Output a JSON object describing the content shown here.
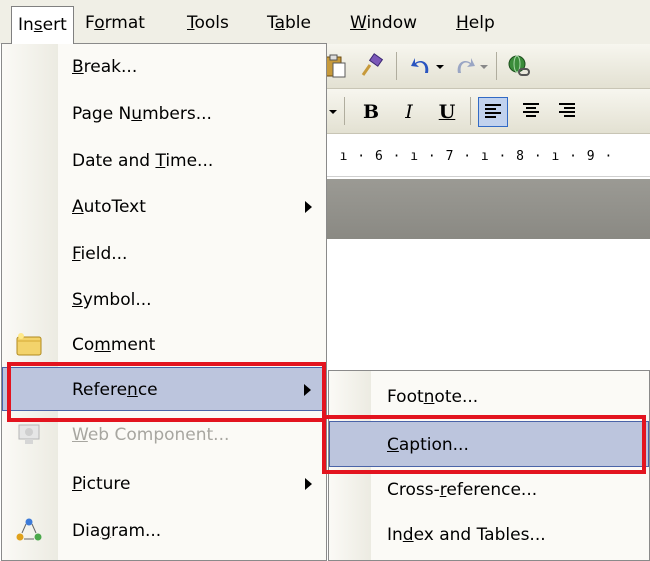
{
  "menubar": {
    "items": [
      {
        "label": "Insert",
        "mnemonic_index": 2
      },
      {
        "label": "Format",
        "mnemonic_index": 1
      },
      {
        "label": "Tools",
        "mnemonic_index": 0
      },
      {
        "label": "Table",
        "mnemonic_index": 1
      },
      {
        "label": "Window",
        "mnemonic_index": 0
      },
      {
        "label": "Help",
        "mnemonic_index": 0
      }
    ]
  },
  "insert_menu": {
    "items": [
      {
        "label": "Break...",
        "mnemonic_index": 0
      },
      {
        "label": "Page Numbers...",
        "mnemonic_index": 6
      },
      {
        "label": "Date and Time...",
        "mnemonic_index": 9
      },
      {
        "label": "AutoText",
        "mnemonic_index": 0,
        "has_submenu": true
      },
      {
        "label": "Field...",
        "mnemonic_index": 0
      },
      {
        "label": "Symbol...",
        "mnemonic_index": 0
      },
      {
        "label": "Comment",
        "mnemonic_index": 2,
        "icon": "comment-icon"
      },
      {
        "label": "Reference",
        "mnemonic_index": 6,
        "has_submenu": true,
        "highlighted": true
      },
      {
        "label": "Web Component...",
        "mnemonic_index": 0,
        "disabled": true,
        "icon": "web-component-icon"
      },
      {
        "label": "Picture",
        "mnemonic_index": 0,
        "has_submenu": true
      },
      {
        "label": "Diagram...",
        "mnemonic_index": 3,
        "icon": "diagram-icon"
      }
    ]
  },
  "reference_submenu": {
    "items": [
      {
        "label": "Footnote...",
        "mnemonic_index": 4
      },
      {
        "label": "Caption...",
        "mnemonic_index": 0,
        "highlighted": true
      },
      {
        "label": "Cross-reference...",
        "mnemonic_index": 6
      },
      {
        "label": "Index and Tables...",
        "mnemonic_index": 2
      }
    ]
  },
  "toolbar": {
    "format_buttons": [
      {
        "label": "B",
        "name": "bold-button"
      },
      {
        "label": "I",
        "name": "italic-button"
      },
      {
        "label": "U",
        "name": "underline-button"
      }
    ]
  },
  "ruler": {
    "text": "· ı · 6 · ı · 7 · ı · 8 · ı · 9 ·"
  },
  "colors": {
    "highlight": "#bcc5dd",
    "highlight_border": "#4a64a8",
    "callout_red": "#e3141f",
    "menu_bg": "#fbfaf6"
  }
}
